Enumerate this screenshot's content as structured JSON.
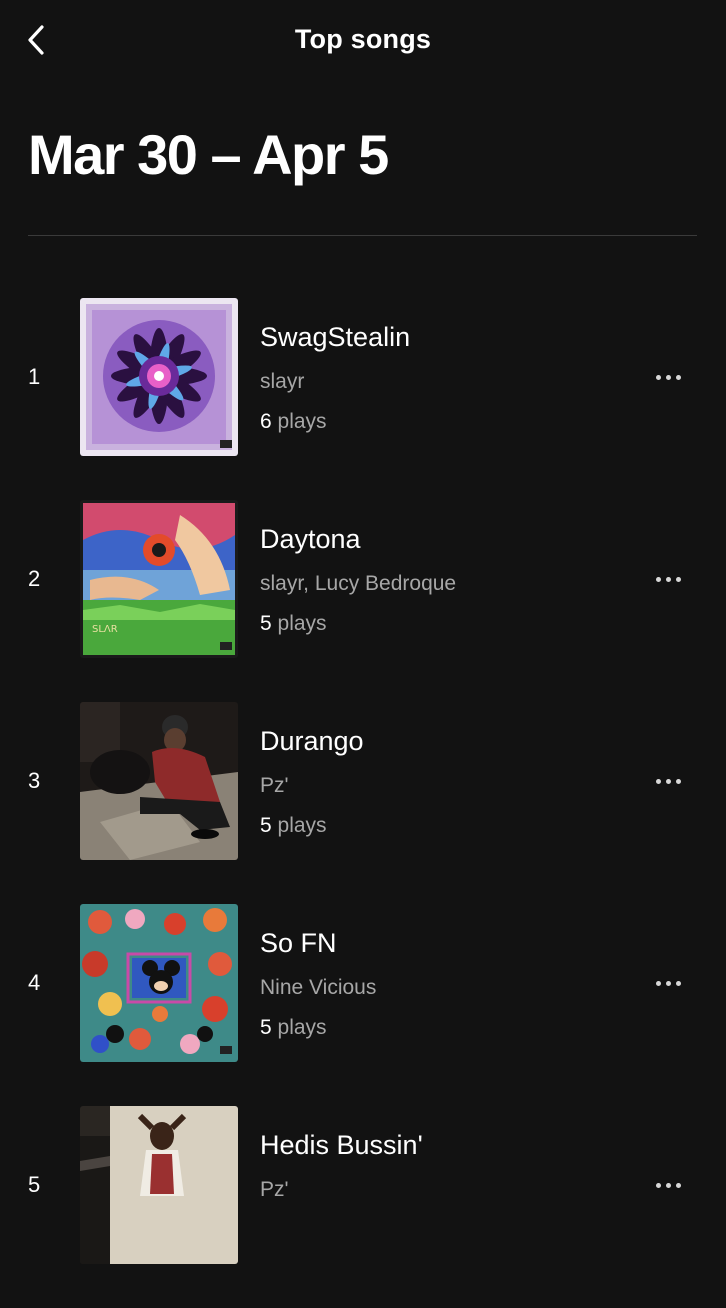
{
  "header": {
    "back_icon": "chevron-left-icon",
    "title": "Top songs"
  },
  "date_range": "Mar 30 – Apr 5",
  "songs": [
    {
      "rank": "1",
      "title": "SwagStealin",
      "artist": "slayr",
      "plays_count": "6",
      "plays_label": " plays",
      "cover": "purple-mandala-cover"
    },
    {
      "rank": "2",
      "title": "Daytona",
      "artist": "slayr, Lucy Bedroque",
      "plays_count": "5",
      "plays_label": " plays",
      "cover": "psychedelic-hands-cover"
    },
    {
      "rank": "3",
      "title": "Durango",
      "artist": "Pz'",
      "plays_count": "5",
      "plays_label": " plays",
      "cover": "night-photo-cover"
    },
    {
      "rank": "4",
      "title": "So FN",
      "artist": "Nine Vicious",
      "plays_count": "5",
      "plays_label": " plays",
      "cover": "cartoon-collage-cover"
    },
    {
      "rank": "5",
      "title": "Hedis Bussin'",
      "artist": "Pz'",
      "plays_count": "",
      "plays_label": "",
      "cover": "street-photo-cover"
    }
  ],
  "more_icon": "more-horizontal-icon",
  "colors": {
    "background": "#121212",
    "primary_text": "#ffffff",
    "secondary_text": "#a7a7a7",
    "divider": "#3a3a3a"
  }
}
